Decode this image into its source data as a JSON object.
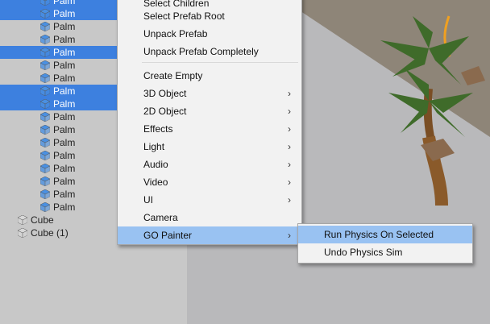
{
  "hierarchy": {
    "items": [
      {
        "label": "Palm",
        "selected": true
      },
      {
        "label": "Palm",
        "selected": true
      },
      {
        "label": "Palm",
        "selected": false
      },
      {
        "label": "Palm",
        "selected": false
      },
      {
        "label": "Palm",
        "selected": true
      },
      {
        "label": "Palm",
        "selected": false
      },
      {
        "label": "Palm",
        "selected": false
      },
      {
        "label": "Palm",
        "selected": true
      },
      {
        "label": "Palm",
        "selected": true
      },
      {
        "label": "Palm",
        "selected": false
      },
      {
        "label": "Palm",
        "selected": false
      },
      {
        "label": "Palm",
        "selected": false
      },
      {
        "label": "Palm",
        "selected": false
      },
      {
        "label": "Palm",
        "selected": false
      },
      {
        "label": "Palm",
        "selected": false
      },
      {
        "label": "Palm",
        "selected": false
      },
      {
        "label": "Palm",
        "selected": false
      },
      {
        "label": "Cube",
        "selected": false
      },
      {
        "label": "Cube (1)",
        "selected": false
      }
    ]
  },
  "context_menu": {
    "items": [
      {
        "label": "Select Children",
        "submenu": false
      },
      {
        "label": "Select Prefab Root",
        "submenu": false
      },
      {
        "label": "Unpack Prefab",
        "submenu": false
      },
      {
        "label": "Unpack Prefab Completely",
        "submenu": false
      },
      {
        "label": "Create Empty",
        "submenu": false
      },
      {
        "label": "3D Object",
        "submenu": true
      },
      {
        "label": "2D Object",
        "submenu": true
      },
      {
        "label": "Effects",
        "submenu": true
      },
      {
        "label": "Light",
        "submenu": true
      },
      {
        "label": "Audio",
        "submenu": true
      },
      {
        "label": "Video",
        "submenu": true
      },
      {
        "label": "UI",
        "submenu": true
      },
      {
        "label": "Camera",
        "submenu": false
      },
      {
        "label": "GO Painter",
        "submenu": true,
        "highlighted": true
      }
    ],
    "arrow_glyph": "›"
  },
  "submenu": {
    "items": [
      {
        "label": "Run Physics On Selected",
        "highlighted": true
      },
      {
        "label": "Undo Physics Sim",
        "highlighted": false
      }
    ]
  },
  "colors": {
    "selection": "#3d80df",
    "menu_highlight": "#99c2f2",
    "menu_bg": "#f2f2f2",
    "panel_bg": "#c8c8c8",
    "prefab_icon": "#4a90e2",
    "cube_icon": "#d8d8d8"
  },
  "icons": {
    "prefab": "prefab-cube-icon",
    "gameobject": "gameobject-cube-icon",
    "submenu": "chevron-right-icon"
  }
}
